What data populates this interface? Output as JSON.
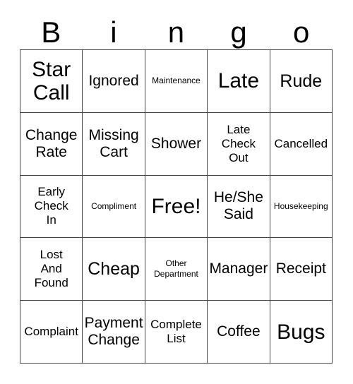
{
  "card": {
    "title_letters": [
      "B",
      "i",
      "n",
      "g",
      "o"
    ],
    "rows": [
      [
        {
          "text": "Star\nCall",
          "size": "xl"
        },
        {
          "text": "Ignored",
          "size": "md"
        },
        {
          "text": "Maintenance",
          "size": "xs"
        },
        {
          "text": "Late",
          "size": "xl"
        },
        {
          "text": "Rude",
          "size": "lg"
        }
      ],
      [
        {
          "text": "Change\nRate",
          "size": "md"
        },
        {
          "text": "Missing\nCart",
          "size": "md"
        },
        {
          "text": "Shower",
          "size": "md"
        },
        {
          "text": "Late\nCheck\nOut",
          "size": "sm"
        },
        {
          "text": "Cancelled",
          "size": "sm"
        }
      ],
      [
        {
          "text": "Early\nCheck\nIn",
          "size": "sm"
        },
        {
          "text": "Compliment",
          "size": "xs"
        },
        {
          "text": "Free!",
          "size": "xl"
        },
        {
          "text": "He/She\nSaid",
          "size": "md"
        },
        {
          "text": "Housekeeping",
          "size": "xs"
        }
      ],
      [
        {
          "text": "Lost\nAnd\nFound",
          "size": "sm"
        },
        {
          "text": "Cheap",
          "size": "lg"
        },
        {
          "text": "Other\nDepartment",
          "size": "xs"
        },
        {
          "text": "Manager",
          "size": "md"
        },
        {
          "text": "Receipt",
          "size": "md"
        }
      ],
      [
        {
          "text": "Complaint",
          "size": "sm"
        },
        {
          "text": "Payment\nChange",
          "size": "md"
        },
        {
          "text": "Complete\nList",
          "size": "sm"
        },
        {
          "text": "Coffee",
          "size": "md"
        },
        {
          "text": "Bugs",
          "size": "xl"
        }
      ]
    ],
    "colors": {
      "background": "#ffffff",
      "border": "#444444",
      "text": "#000000"
    }
  }
}
